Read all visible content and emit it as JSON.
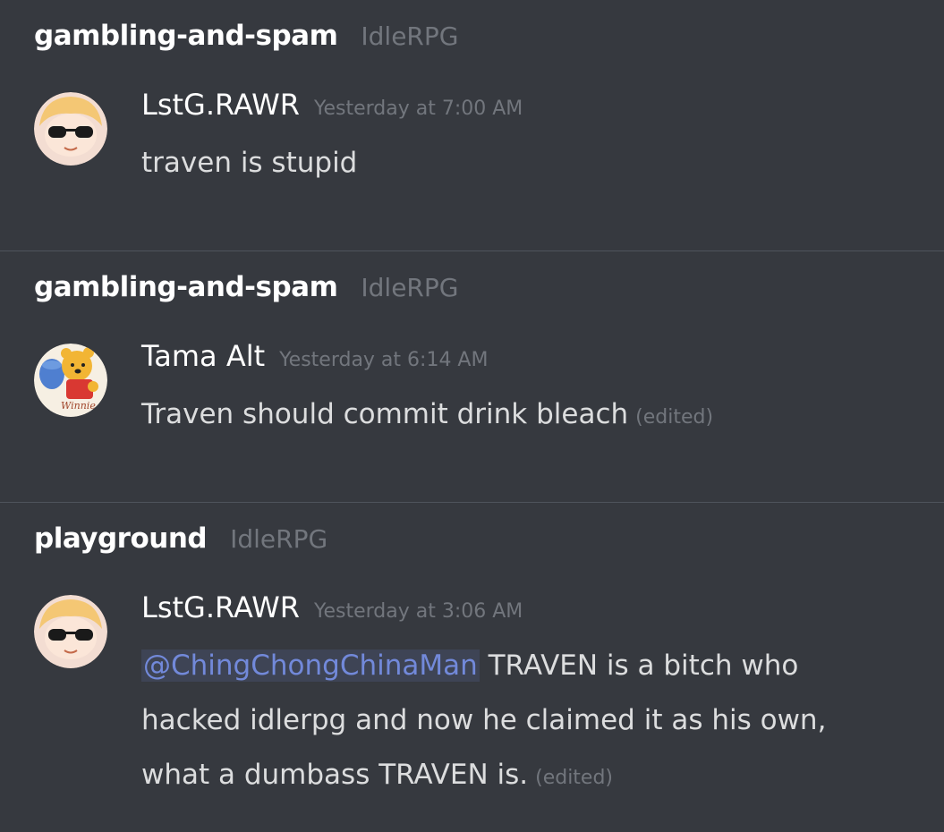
{
  "groups": [
    {
      "channel": "gambling-and-spam",
      "server": "IdleRPG",
      "message": {
        "author": "LstG.RAWR",
        "timestamp": "Yesterday at 7:00 AM",
        "avatar": "sunglasses-anime-avatar",
        "text": "traven is stupid",
        "edited": ""
      }
    },
    {
      "channel": "gambling-and-spam",
      "server": "IdleRPG",
      "message": {
        "author": "Tama Alt",
        "timestamp": "Yesterday at 6:14 AM",
        "avatar": "winnie-the-pooh-avatar",
        "text": "Traven should commit drink bleach",
        "edited": "(edited)"
      }
    },
    {
      "channel": "playground",
      "server": "IdleRPG",
      "message": {
        "author": "LstG.RAWR",
        "timestamp": "Yesterday at 3:06 AM",
        "avatar": "sunglasses-anime-avatar",
        "mention": "@ChingChongChinaMan",
        "text": " TRAVEN is a bitch who hacked idlerpg and now he claimed it as his own, what a dumbass TRAVEN is.",
        "edited": "(edited)"
      }
    }
  ],
  "avatar_labels": {
    "pooh_text": "Winnie"
  },
  "colors": {
    "background": "#36393f",
    "divider": "#4f545c",
    "mention": "#7289da",
    "muted": "#72767d"
  }
}
